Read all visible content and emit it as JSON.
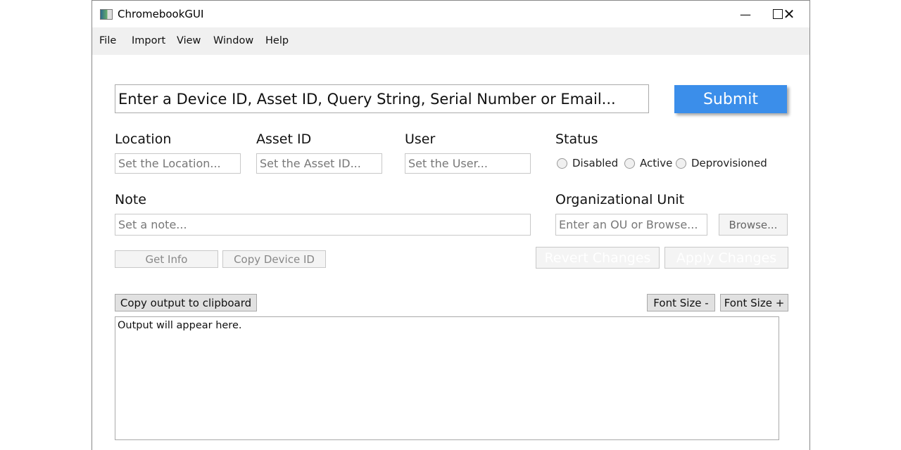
{
  "window": {
    "title": "ChromebookGUI",
    "controls": [
      "minimize",
      "maximize",
      "close"
    ]
  },
  "menu": [
    "File",
    "Import",
    "View",
    "Window",
    "Help"
  ],
  "search": {
    "placeholder": "Enter a Device ID, Asset ID, Query String, Serial Number or Email...",
    "submit": "Submit",
    "accent": "#3b8eea"
  },
  "fields": {
    "location": {
      "label": "Location",
      "placeholder": "Set the Location..."
    },
    "asset": {
      "label": "Asset ID",
      "placeholder": "Set the Asset ID..."
    },
    "user": {
      "label": "User",
      "placeholder": "Set the User..."
    },
    "note": {
      "label": "Note",
      "placeholder": "Set a note..."
    },
    "ou": {
      "label": "Organizational Unit",
      "placeholder": "Enter an OU or Browse...",
      "browse": "Browse..."
    }
  },
  "status": {
    "label": "Status",
    "options": [
      "Disabled",
      "Active",
      "Deprovisioned"
    ]
  },
  "buttons": {
    "get_info": "Get Info",
    "copy_id": "Copy Device ID",
    "revert": "Revert Changes",
    "apply": "Apply Changes",
    "copy_output": "Copy output to clipboard",
    "font_minus": "Font Size -",
    "font_plus": "Font Size +"
  },
  "output": {
    "text": "Output will appear here."
  }
}
